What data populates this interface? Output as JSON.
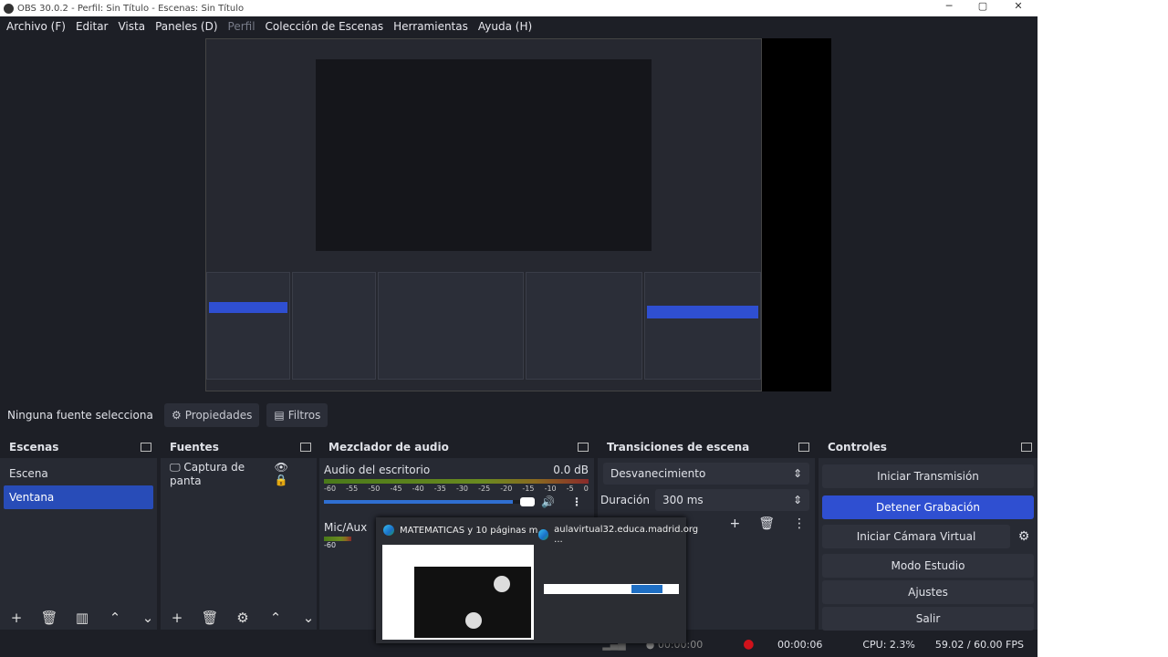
{
  "window": {
    "title": "OBS 30.0.2 - Perfil: Sin Título - Escenas: Sin Título"
  },
  "menu": [
    "Archivo (F)",
    "Editar",
    "Vista",
    "Paneles (D)",
    "Perfil",
    "Colección de Escenas",
    "Herramientas",
    "Ayuda (H)"
  ],
  "source_bar": {
    "label": "Ninguna fuente selecciona",
    "properties": "Propiedades",
    "filters": "Filtros"
  },
  "scenes": {
    "title": "Escenas",
    "items": [
      "Escena",
      "Ventana"
    ],
    "selected": 1
  },
  "sources": {
    "title": "Fuentes",
    "items": [
      "Captura de panta"
    ]
  },
  "mixer": {
    "title": "Mezclador de audio",
    "channels": [
      {
        "name": "Audio del escritorio",
        "level": "0.0 dB"
      },
      {
        "name": "Mic/Aux"
      }
    ],
    "ticks": [
      "-60",
      "-55",
      "-50",
      "-45",
      "-40",
      "-35",
      "-30",
      "-25",
      "-20",
      "-15",
      "-10",
      "-5",
      "0"
    ],
    "tick2": "-60",
    "volume_percent": 90
  },
  "transitions": {
    "title": "Transiciones de escena",
    "selected": "Desvanecimiento",
    "duration_label": "Duración",
    "duration": "300 ms"
  },
  "controls": {
    "title": "Controles",
    "buttons": [
      "Iniciar Transmisión",
      "Detener Grabación",
      "Iniciar Cámara Virtual",
      "Modo Estudio",
      "Ajustes",
      "Salir"
    ]
  },
  "status": {
    "stream_time": "00:00:00",
    "rec_time": "00:00:06",
    "cpu": "CPU: 2.3%",
    "fps": "59.02 / 60.00 FPS"
  },
  "taskbar_preview": {
    "items": [
      "MATEMATICAS y 10 páginas m...",
      "aulavirtual32.educa.madrid.org ..."
    ]
  },
  "colors": {
    "accent": "#2f4fd1",
    "bg": "#1d1f26",
    "panel": "#272a33",
    "rec": "#d0121b"
  }
}
